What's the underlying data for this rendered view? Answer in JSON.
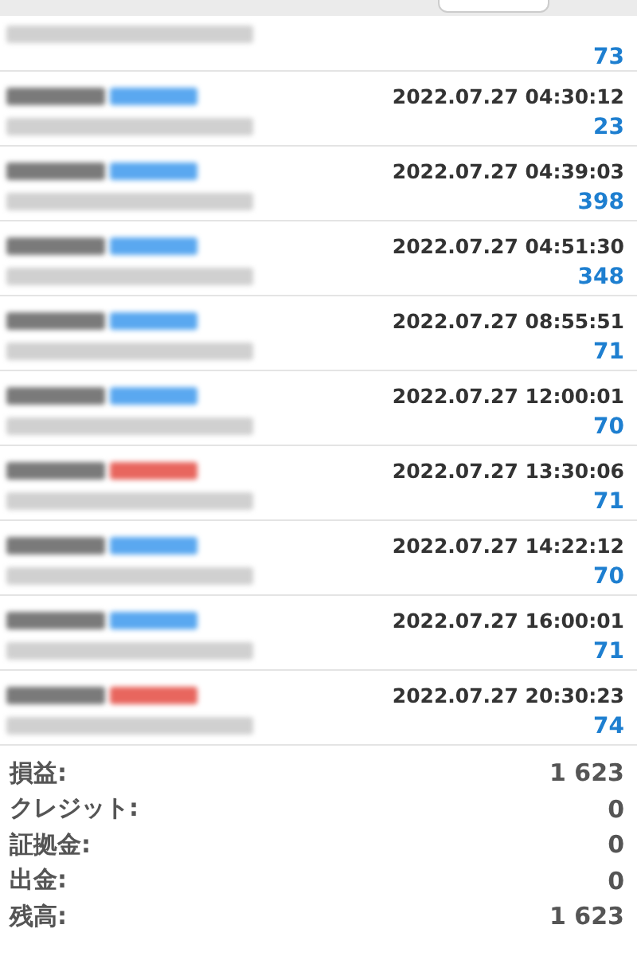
{
  "first_row": {
    "profit": "73"
  },
  "deals": [
    {
      "kind": "buy",
      "time": "2022.07.27 04:30:12",
      "profit": "23"
    },
    {
      "kind": "buy",
      "time": "2022.07.27 04:39:03",
      "profit": "398"
    },
    {
      "kind": "buy",
      "time": "2022.07.27 04:51:30",
      "profit": "348"
    },
    {
      "kind": "buy",
      "time": "2022.07.27 08:55:51",
      "profit": "71"
    },
    {
      "kind": "buy",
      "time": "2022.07.27 12:00:01",
      "profit": "70"
    },
    {
      "kind": "sell",
      "time": "2022.07.27 13:30:06",
      "profit": "71"
    },
    {
      "kind": "buy",
      "time": "2022.07.27 14:22:12",
      "profit": "70"
    },
    {
      "kind": "buy",
      "time": "2022.07.27 16:00:01",
      "profit": "71"
    },
    {
      "kind": "sell",
      "time": "2022.07.27 20:30:23",
      "profit": "74"
    }
  ],
  "summary": [
    {
      "label": "損益:",
      "value": "1 623"
    },
    {
      "label": "クレジット:",
      "value": "0"
    },
    {
      "label": "証拠金:",
      "value": "0"
    },
    {
      "label": "出金:",
      "value": "0"
    },
    {
      "label": "残高:",
      "value": "1 623"
    }
  ]
}
